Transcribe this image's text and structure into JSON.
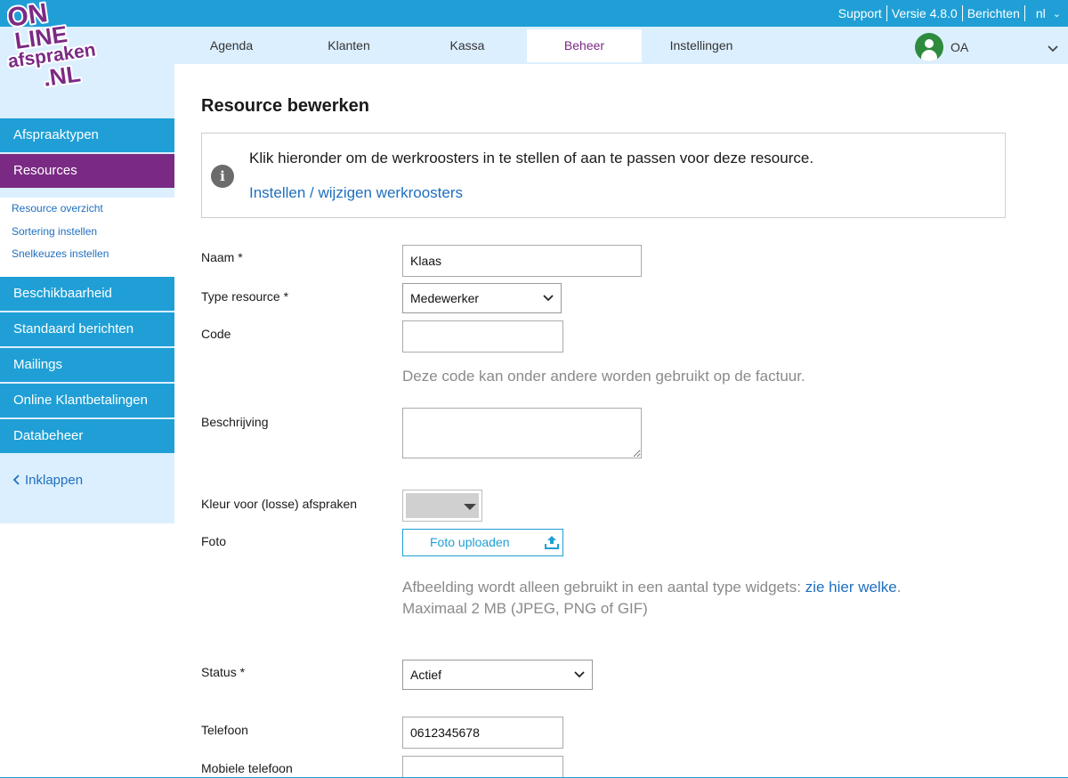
{
  "topbar": {
    "links": [
      "Support",
      "Versie 4.8.0",
      "Berichten"
    ],
    "language": "nl"
  },
  "logo": {
    "lines": [
      "ON",
      "LINE",
      "afspraken",
      ".NL"
    ]
  },
  "nav": {
    "tabs": [
      "Agenda",
      "Klanten",
      "Kassa",
      "Beheer",
      "Instellingen"
    ],
    "active": "Beheer",
    "user_initials": "OA"
  },
  "sidebar": {
    "items": [
      "Afspraaktypen",
      "Resources",
      "Beschikbaarheid",
      "Standaard berichten",
      "Mailings",
      "Online Klantbetalingen",
      "Databeheer"
    ],
    "active": "Resources",
    "subitems": [
      "Resource overzicht",
      "Sortering instellen",
      "Snelkeuzes instellen"
    ],
    "collapse": "Inklappen"
  },
  "page": {
    "title": "Resource bewerken",
    "info_text": "Klik hieronder om de werkroosters in te stellen of aan te passen voor deze resource.",
    "info_link": "Instellen / wijzigen werkroosters"
  },
  "form": {
    "naam_label": "Naam *",
    "naam_value": "Klaas",
    "type_label": "Type resource *",
    "type_value": "Medewerker",
    "code_label": "Code",
    "code_value": "",
    "code_hint": "Deze code kan onder andere worden gebruikt op de factuur.",
    "beschrijving_label": "Beschrijving",
    "beschrijving_value": "",
    "kleur_label": "Kleur voor (losse) afspraken",
    "kleur_value": "#d0d0d0",
    "foto_label": "Foto",
    "foto_button": "Foto uploaden",
    "foto_hint_prefix": "Afbeelding wordt alleen gebruikt in een aantal type widgets: ",
    "foto_hint_link": "zie hier welke",
    "foto_hint_suffix": ".",
    "foto_hint2": "Maximaal 2 MB (JPEG, PNG of GIF)",
    "status_label": "Status *",
    "status_value": "Actief",
    "telefoon_label": "Telefoon",
    "telefoon_value": "0612345678",
    "mobiel_label": "Mobiele telefoon",
    "mobiel_value": ""
  },
  "colors": {
    "primary": "#1f9fd6",
    "brand": "#7b2a84",
    "light": "#dcefff",
    "avatar": "#2e8b3e",
    "link": "#1f6fbf"
  }
}
